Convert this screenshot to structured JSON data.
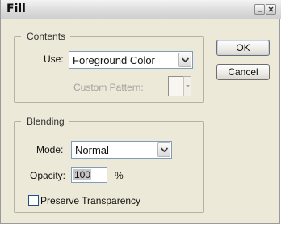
{
  "window": {
    "title": "Fill"
  },
  "contents": {
    "legend": "Contents",
    "use_label": "Use:",
    "use_value": "Foreground Color",
    "custom_pattern_label": "Custom Pattern:"
  },
  "blending": {
    "legend": "Blending",
    "mode_label": "Mode:",
    "mode_value": "Normal",
    "opacity_label": "Opacity:",
    "opacity_value": "100",
    "opacity_unit": "%",
    "preserve_label": "Preserve Transparency",
    "preserve_checked": false
  },
  "buttons": {
    "ok": "OK",
    "cancel": "Cancel"
  },
  "icons": {
    "minimize": "minimize-icon",
    "close": "close-icon",
    "dropdown": "chevron-down-icon"
  }
}
